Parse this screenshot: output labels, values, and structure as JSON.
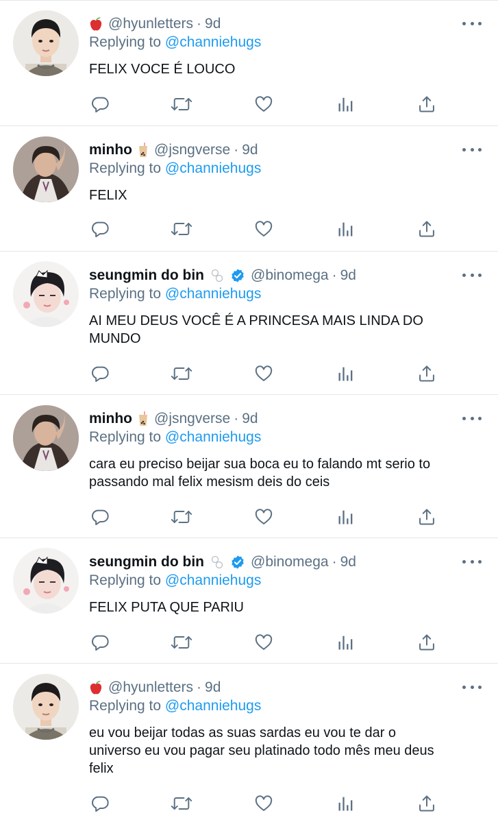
{
  "replying_label": "Replying to",
  "tweets": [
    {
      "display_name": "",
      "emoji": "apple",
      "handle": "@hyunletters",
      "dot": "·",
      "time": "9d",
      "reply_to": "@channiehugs",
      "lines": [
        "FELIX VOCE É LOUCO"
      ],
      "verified": false
    },
    {
      "display_name": "minho",
      "emoji": "bubble-tea",
      "handle": "@jsngverse",
      "dot": "·",
      "time": "9d",
      "reply_to": "@channiehugs",
      "lines": [
        "FELIX"
      ],
      "verified": false
    },
    {
      "display_name": "seungmin do bin",
      "emoji": "infinity-symbol",
      "handle": "@binomega",
      "dot": "·",
      "time": "9d",
      "reply_to": "@channiehugs",
      "lines": [
        "AI MEU DEUS VOCÊ É A PRINCESA MAIS LINDA DO",
        "MUNDO"
      ],
      "verified": true
    },
    {
      "display_name": "minho",
      "emoji": "bubble-tea",
      "handle": "@jsngverse",
      "dot": "·",
      "time": "9d",
      "reply_to": "@channiehugs",
      "lines": [
        "cara eu preciso beijar sua boca eu to falando mt serio to",
        "passando mal felix mesism deis do ceis"
      ],
      "verified": false
    },
    {
      "display_name": "seungmin do bin",
      "emoji": "infinity-symbol",
      "handle": "@binomega",
      "dot": "·",
      "time": "9d",
      "reply_to": "@channiehugs",
      "lines": [
        "FELIX PUTA QUE PARIU"
      ],
      "verified": true
    },
    {
      "display_name": "",
      "emoji": "apple",
      "handle": "@hyunletters",
      "dot": "·",
      "time": "9d",
      "reply_to": "@channiehugs",
      "lines": [
        "eu vou beijar todas as suas sardas eu vou te dar o",
        "universo eu vou pagar seu platinado todo mês meu deus",
        "felix"
      ],
      "verified": false
    }
  ],
  "colors": {
    "text": "#0f1419",
    "secondary": "#5b7083",
    "link": "#1d9bf0",
    "verified": "#1d9bf0",
    "divider": "#e3e6e8"
  }
}
